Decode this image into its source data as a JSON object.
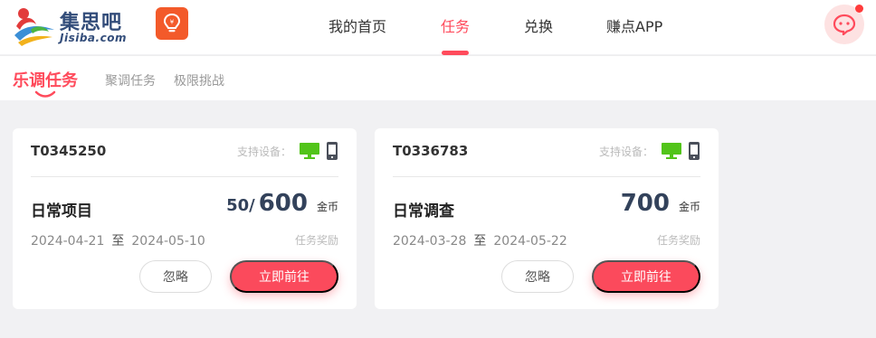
{
  "header": {
    "logo_brand": "集思吧",
    "logo_domain": "Jisiba.com",
    "nav": [
      {
        "label": "我的首页"
      },
      {
        "label": "任务"
      },
      {
        "label": "兑换"
      },
      {
        "label": "赚点APP"
      }
    ],
    "active_nav": "任务"
  },
  "subnav": {
    "title": "乐调任务",
    "tabs": [
      {
        "label": "聚调任务"
      },
      {
        "label": "极限挑战"
      }
    ]
  },
  "cards": [
    {
      "code": "T0345250",
      "devices_label": "支持设备：",
      "name": "日常项目",
      "reward_prefix": "50/",
      "reward": "600",
      "reward_unit": "金币",
      "start_date": "2024-04-21",
      "to": "至",
      "end_date": "2024-05-10",
      "reward_label": "任务奖励",
      "ignore_label": "忽略",
      "go_label": "立即前往"
    },
    {
      "code": "T0336783",
      "devices_label": "支持设备：",
      "name": "日常调查",
      "reward_prefix": "",
      "reward": "700",
      "reward_unit": "金币",
      "start_date": "2024-03-28",
      "to": "至",
      "end_date": "2024-05-22",
      "reward_label": "任务奖励",
      "ignore_label": "忽略",
      "go_label": "立即前往"
    }
  ],
  "colors": {
    "accent": "#ff4b5c",
    "button": "#fb4a5c",
    "number": "#33425b",
    "device_green": "#52c41a",
    "device_dark": "#4a4f5a",
    "logo_badge": "#f35a2a"
  },
  "icons": [
    "jisiba-logo-icon",
    "lightbulb-coin-icon",
    "chat-bubble-icon",
    "desktop-monitor-icon",
    "mobile-phone-icon"
  ]
}
